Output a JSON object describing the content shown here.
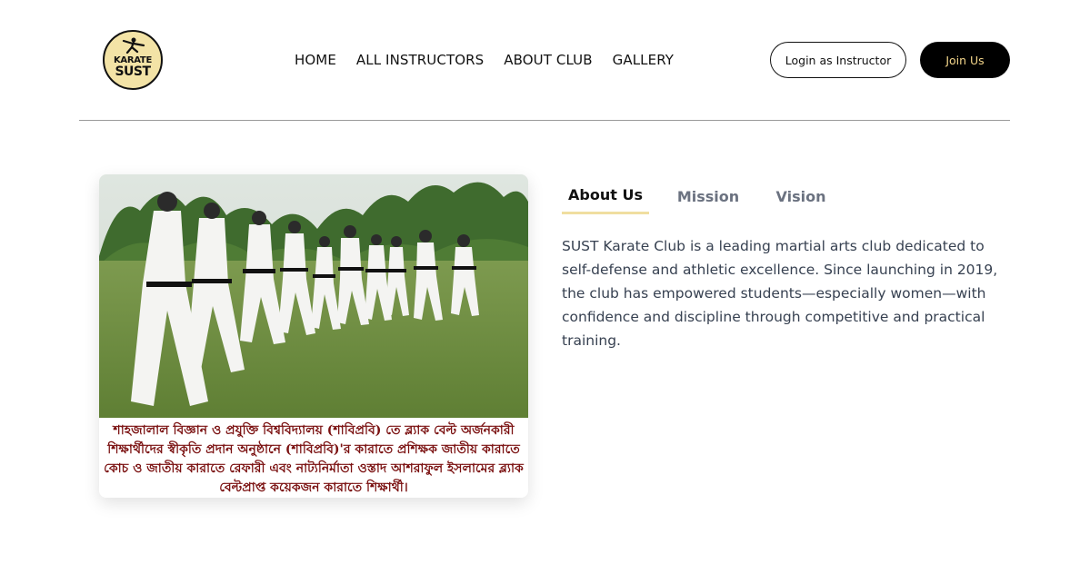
{
  "header": {
    "logo": {
      "line1": "KARATE",
      "line2": "SUST"
    },
    "nav": [
      {
        "label": "HOME"
      },
      {
        "label": "ALL INSTRUCTORS"
      },
      {
        "label": "ABOUT CLUB"
      },
      {
        "label": "GALLERY"
      }
    ],
    "login_label": "Login as Instructor",
    "join_label": "Join Us"
  },
  "photo": {
    "caption": "শাহজালাল বিজ্ঞান ও প্রযুক্তি বিশ্ববিদ্যালয় (শাবিপ্রবি) তে ব্ল্যাক বেল্ট অর্জনকারী শিক্ষার্থীদের স্বীকৃতি প্রদান অনুষ্ঠানে (শাবিপ্রবি)'র কারাতে প্রশিক্ষক জাতীয় কারাতে কোচ ও জাতীয় কারাতে রেফারী এবং নাট্যনির্মাতা ওস্তাদ আশরাফুল ইসলামের ব্ল্যাক বেল্টপ্রাপ্ত কয়েকজন কারাতে শিক্ষার্থী।"
  },
  "tabs": [
    {
      "label": "About Us",
      "active": true
    },
    {
      "label": "Mission",
      "active": false
    },
    {
      "label": "Vision",
      "active": false
    }
  ],
  "content": {
    "about": "SUST Karate Club is a leading martial arts club dedicated to self-defense and athletic excellence. Since launching in 2019, the club has empowered students—especially women—with confidence and discipline through competitive and practical training."
  },
  "colors": {
    "accent": "#f0dea0",
    "join_text": "#f3d58a",
    "caption_text": "#7a1010"
  }
}
